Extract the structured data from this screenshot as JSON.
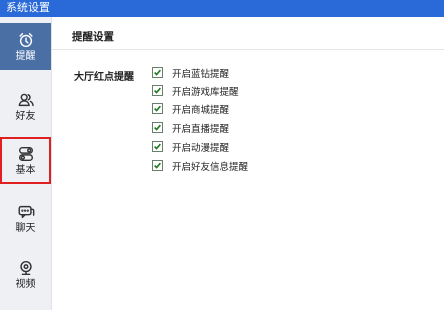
{
  "window": {
    "title": "系统设置"
  },
  "sidebar": {
    "items": [
      {
        "label": "提醒",
        "icon": "alarm-clock-icon",
        "active": true
      },
      {
        "label": "好友",
        "icon": "friends-icon"
      },
      {
        "label": "基本",
        "icon": "toggle-switch-icon",
        "highlighted": true
      },
      {
        "label": "聊天",
        "icon": "chat-bubble-icon"
      },
      {
        "label": "视频",
        "icon": "webcam-icon"
      }
    ]
  },
  "main": {
    "title": "提醒设置",
    "section_label": "大厅红点提醒",
    "options": [
      {
        "label": "开启蓝钻提醒",
        "checked": true
      },
      {
        "label": "开启游戏库提醒",
        "checked": true
      },
      {
        "label": "开启商城提醒",
        "checked": true
      },
      {
        "label": "开启直播提醒",
        "checked": true
      },
      {
        "label": "开启动漫提醒",
        "checked": true
      },
      {
        "label": "开启好友信息提醒",
        "checked": true
      }
    ]
  },
  "colors": {
    "titlebar": "#2a6ad8",
    "active_nav": "#4a6fa5",
    "highlight_border": "#e02020",
    "checkmark": "#1e7a1e"
  }
}
